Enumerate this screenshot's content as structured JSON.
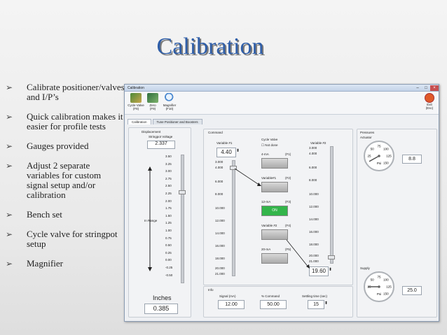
{
  "slide": {
    "title": "Calibration",
    "bullets": [
      "Calibrate positioner/valves and I/P’s",
      "Quick calibration makes it easier for profile tests",
      "Gauges provided",
      "Adjust 2 separate variables for custom signal setup and/or calibration",
      "Bench set",
      "Cycle valve for stringpot setup",
      "Magnifier"
    ]
  },
  "window": {
    "title": "Calibration",
    "toolbar": [
      {
        "label": "Cycle\nValve",
        "key": "(F8)"
      },
      {
        "label": "Zero",
        "key": "(F9)"
      },
      {
        "label": "Magnifier",
        "key": "(F10)"
      }
    ],
    "exit": {
      "label": "Exit",
      "key": "(Esc)"
    },
    "tabs": [
      "Calibration",
      "Tune Positioner and Boosters"
    ],
    "displacement": {
      "header": "Displacement",
      "sub": "Stringpot Voltage",
      "voltage": "2.337",
      "ticks": [
        "3.50",
        "3.25",
        "3.00",
        "2.75",
        "2.50",
        "2.25",
        "2.00",
        "1.75",
        "1.50",
        "1.25",
        "1.00",
        "0.75",
        "0.50",
        "0.25",
        "0.00",
        "-0.25",
        "-0.50"
      ],
      "range_label": "In Range",
      "unit": "Inches",
      "inches": "0.385"
    },
    "command": {
      "header": "Command",
      "var1_label": "Variable #1",
      "var1_value": "4.40",
      "var2_label": "Variable #2",
      "var2_value": "19.60",
      "var1_ticks": [
        "3.000",
        "4.000",
        "6.000",
        "8.000",
        "10.000",
        "12.000",
        "14.000",
        "16.000",
        "18.000",
        "20.000",
        "21.000"
      ],
      "var2_ticks": [
        "3.000",
        "4.000",
        "6.000",
        "8.000",
        "10.000",
        "12.000",
        "14.000",
        "16.000",
        "18.000",
        "20.000",
        "21.000"
      ],
      "cycle_valve": "Cycle Valve",
      "not_done": "Not done",
      "presets": [
        {
          "label": "4-mA",
          "key": "(F1)",
          "on": false,
          "text": ""
        },
        {
          "label": "Variable#1",
          "key": "(F2)",
          "on": false,
          "text": ""
        },
        {
          "label": "12-mA",
          "key": "(F3)",
          "on": true,
          "text": "ON"
        },
        {
          "label": "Variable #2",
          "key": "(F4)",
          "on": false,
          "text": ""
        },
        {
          "label": "20-mA",
          "key": "(F5)",
          "on": false,
          "text": ""
        }
      ]
    },
    "pressures": {
      "header": "Pressures",
      "actuator": {
        "label": "Actuator",
        "value": "8.8",
        "ticks": [
          "25",
          "50",
          "75",
          "100",
          "125",
          "150"
        ],
        "unit": "Psi",
        "level": 8.8
      },
      "supply": {
        "label": "Supply",
        "value": "25.0",
        "ticks": [
          "25",
          "50",
          "75",
          "100",
          "125",
          "150"
        ],
        "unit": "Psi",
        "level": 25.0
      }
    },
    "info": {
      "header": "Info",
      "signal_label": "Signal (mA)",
      "signal": "12.00",
      "percent_label": "% Command",
      "percent": "50.00",
      "settle_label": "Settling time (sec)",
      "settle": "15"
    }
  }
}
